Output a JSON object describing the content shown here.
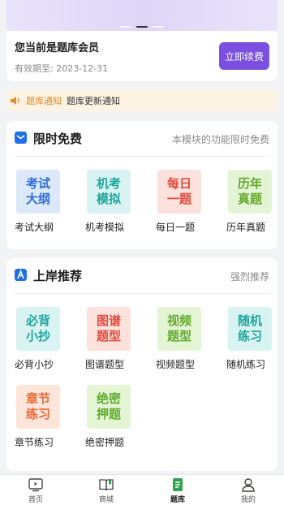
{
  "membership": {
    "title": "您当前是题库会员",
    "expire": "有效期至: 2023-12-31",
    "renew_label": "立即续费"
  },
  "notice": {
    "tag": "题库通知",
    "message": "题库更新通知"
  },
  "section_free": {
    "title": "限时免费",
    "subtitle": "本模块的功能限时免费",
    "items": [
      {
        "line1": "考试",
        "line2": "大纲",
        "label": "考试大纲"
      },
      {
        "line1": "机考",
        "line2": "模拟",
        "label": "机考模拟"
      },
      {
        "line1": "每日",
        "line2": "一题",
        "label": "每日一题"
      },
      {
        "line1": "历年",
        "line2": "真题",
        "label": "历年真题"
      }
    ]
  },
  "section_recommend": {
    "title": "上岸推荐",
    "subtitle": "强烈推荐",
    "items": [
      {
        "line1": "必背",
        "line2": "小抄",
        "label": "必背小抄"
      },
      {
        "line1": "图谱",
        "line2": "题型",
        "label": "图谱题型"
      },
      {
        "line1": "视频",
        "line2": "题型",
        "label": "视频题型"
      },
      {
        "line1": "随机",
        "line2": "练习",
        "label": "随机练习"
      },
      {
        "line1": "章节",
        "line2": "练习",
        "label": "章节练习"
      },
      {
        "line1": "绝密",
        "line2": "押题",
        "label": "绝密押题"
      }
    ]
  },
  "tabbar": {
    "tabs": [
      {
        "label": "首页",
        "icon": "tv-icon"
      },
      {
        "label": "商城",
        "icon": "book-icon"
      },
      {
        "label": "题库",
        "icon": "document-icon"
      },
      {
        "label": "我的",
        "icon": "user-icon"
      }
    ],
    "active": "题库"
  },
  "colors": {
    "accent_purple": "#7b4fe0",
    "accent_blue": "#1f6fe5",
    "notice_orange": "#e7882a",
    "active_green": "#2fa44f"
  }
}
